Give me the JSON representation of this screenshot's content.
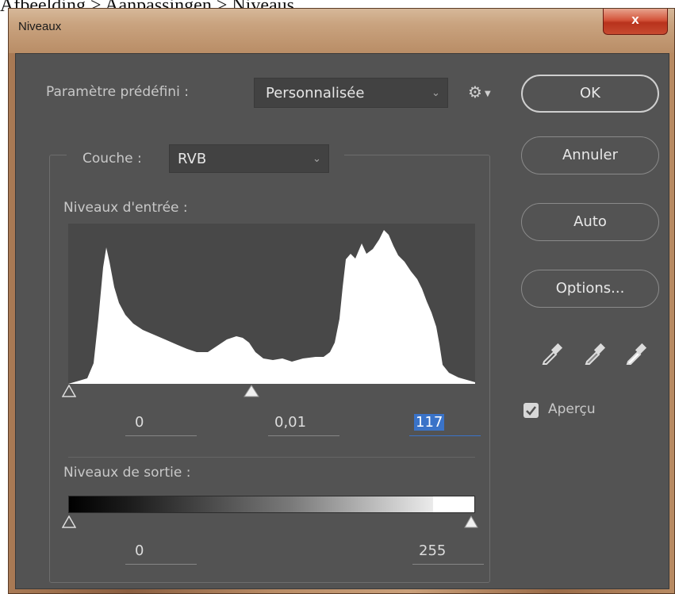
{
  "caption": "Afbeelding > Aanpassingen > Niveaus.",
  "window": {
    "title": "Niveaux",
    "close_label": "x"
  },
  "preset": {
    "label": "Paramètre prédéfini :",
    "value": "Personnalisée"
  },
  "channel": {
    "label": "Couche :",
    "value": "RVB"
  },
  "input_levels": {
    "label": "Niveaux d'entrée :",
    "black": "0",
    "gamma": "0,01",
    "white": "117"
  },
  "output_levels": {
    "label": "Niveaux de sortie :",
    "black": "0",
    "white": "255"
  },
  "buttons": {
    "ok": "OK",
    "cancel": "Annuler",
    "auto": "Auto",
    "options": "Options..."
  },
  "preview": {
    "label": "Aperçu",
    "checked": true
  },
  "icons": {
    "settings": "gear-icon",
    "eyedroppers": [
      "black-eyedropper-icon",
      "gray-eyedropper-icon",
      "white-eyedropper-icon"
    ]
  },
  "colors": {
    "panel": "#535353",
    "field": "#424242",
    "histogram_bg": "#484848",
    "selection": "#3a73c8"
  }
}
